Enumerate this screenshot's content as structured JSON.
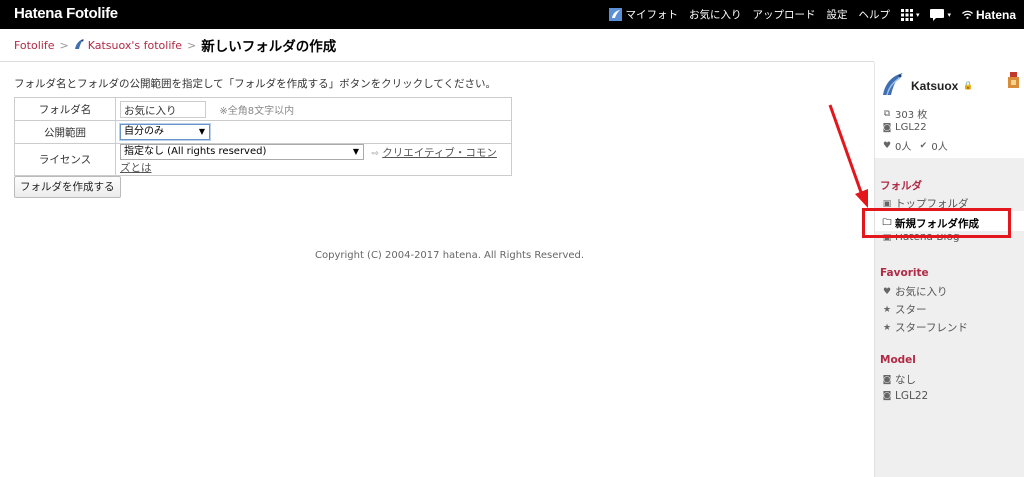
{
  "topbar": {
    "logo": "Hatena Fotolife",
    "nav": {
      "my_photo": "マイフォト",
      "favorites": "お気に入り",
      "upload": "アップロード",
      "settings": "設定",
      "help": "ヘルプ",
      "hatena": "Hatena"
    }
  },
  "breadcrumb": {
    "root": "Fotolife",
    "user_fotolife": "Katsuox's fotolife",
    "sep": ">",
    "current": "新しいフォルダの作成"
  },
  "main": {
    "instruction": "フォルダ名とフォルダの公開範囲を指定して「フォルダを作成する」ボタンをクリックしてください。",
    "form": {
      "name_label": "フォルダ名",
      "name_value": "お気に入り",
      "name_note": "※全角8文字以内",
      "visibility_label": "公開範囲",
      "visibility_value": "自分のみ",
      "license_label": "ライセンス",
      "license_value": "指定なし (All rights reserved)",
      "cc_prefix": "⇨",
      "cc_link": "クリエイティブ・コモンズとは"
    },
    "create_button": "フォルダを作成する",
    "copyright": "Copyright (C) 2004-2017 hatena. All Rights Reserved."
  },
  "sidebar": {
    "username": "Katsuox",
    "lock": "🔒",
    "photo_count": "303 枚",
    "model": "LGL22",
    "hearts": "0人",
    "stars": "0人",
    "folder_head": "フォルダ",
    "top_folder": "トップフォルダ",
    "new_folder": "新規フォルダ作成",
    "hatena_blog": "Hatena Blog",
    "favorite_head": "Favorite",
    "fav_items": [
      "お気に入り",
      "スター",
      "スターフレンド"
    ],
    "model_head": "Model",
    "model_items": [
      "なし",
      "LGL22"
    ]
  },
  "colors": {
    "accent": "#b02a45",
    "highlight": "#e3161c",
    "topbar": "#000000"
  }
}
